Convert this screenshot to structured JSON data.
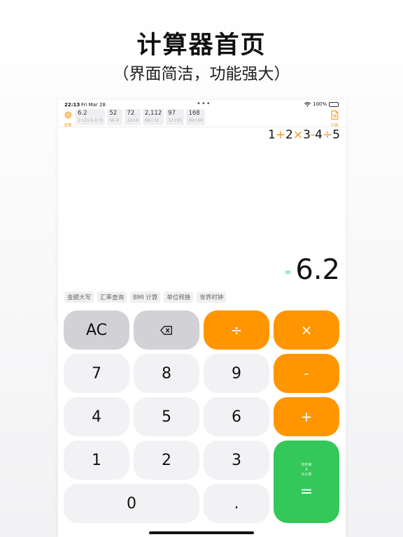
{
  "hero": {
    "title": "计算器首页",
    "subtitle": "（界面简洁，功能强大）"
  },
  "status_bar": {
    "time": "22:13",
    "date": "Fri Mar 28",
    "dots": "•••",
    "battery": "100%"
  },
  "toolbar": {
    "settings_label": "设置",
    "record_label": "记录",
    "history": [
      {
        "result": "6.2",
        "expr": "1+2×3-4÷5"
      },
      {
        "result": "52",
        "expr": "56-4"
      },
      {
        "result": "72",
        "expr": "12×6"
      },
      {
        "result": "2,112",
        "expr": "66×32"
      },
      {
        "result": "97",
        "expr": "32+65"
      },
      {
        "result": "168",
        "expr": "99+69"
      }
    ]
  },
  "display": {
    "expression_tokens": [
      "1",
      "+",
      "2",
      "×",
      "3",
      "-",
      "4",
      "÷",
      "5"
    ],
    "equals": "=",
    "result": "6.2"
  },
  "quick_tools": [
    "金额大写",
    "汇率查询",
    "BMI 计算",
    "单位转换",
    "世界时钟"
  ],
  "keys": {
    "ac": "AC",
    "divide": "÷",
    "multiply": "×",
    "minus": "-",
    "plus": "+",
    "d7": "7",
    "d8": "8",
    "d9": "9",
    "d4": "4",
    "d5": "5",
    "d6": "6",
    "d1": "1",
    "d2": "2",
    "d3": "3",
    "d0": "0",
    "dot": ".",
    "equals_note": [
      "你的第",
      "8",
      "次计算"
    ],
    "equals": "="
  },
  "colors": {
    "accent_orange": "#ff9500",
    "equals_green": "#34c759",
    "function_gray": "#d1d1d6",
    "digit_bg": "#f2f2f5"
  }
}
